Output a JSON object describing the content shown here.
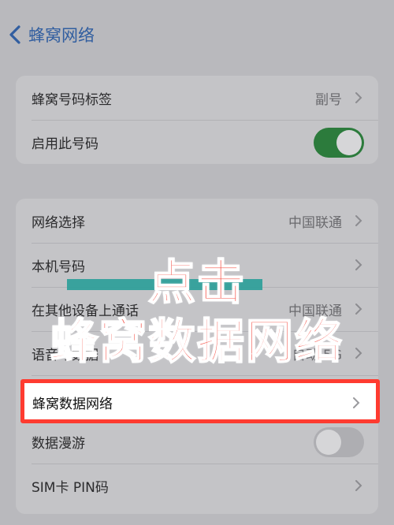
{
  "nav": {
    "back_label": "蜂窝网络"
  },
  "group1": {
    "rows": [
      {
        "label": "蜂窝号码标签",
        "value": "副号"
      },
      {
        "label": "启用此号码",
        "toggle": "on"
      }
    ]
  },
  "group2": {
    "rows": [
      {
        "label": "网络选择",
        "value": "中国联通"
      },
      {
        "label": "本机号码",
        "value": ""
      },
      {
        "label": "在其他设备上通话",
        "value": "中国联通"
      },
      {
        "label": "语音与数据",
        "value": "自动 5G"
      },
      {
        "label": "蜂窝数据网络",
        "value": ""
      },
      {
        "label": "数据漫游",
        "toggle": "off"
      },
      {
        "label": "SIM卡 PIN码",
        "value": ""
      }
    ]
  },
  "overlay": {
    "line1": "点击",
    "line2": "蜂窝数据网络"
  },
  "colors": {
    "highlight_border": "#ff3b30",
    "overlay_text": "#f5544a",
    "accent_bar": "#2a9e98",
    "toggle_on": "#2c7b3c"
  }
}
